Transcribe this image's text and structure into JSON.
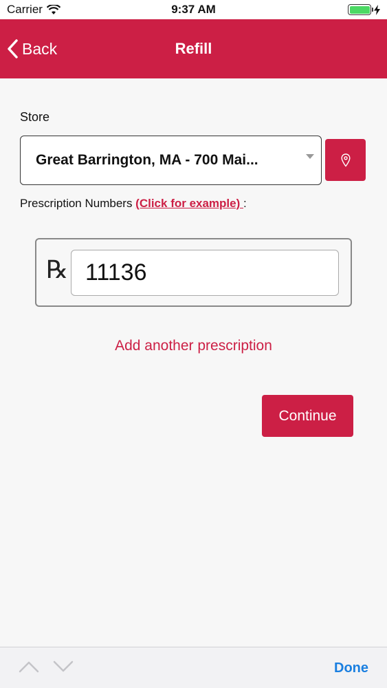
{
  "status_bar": {
    "carrier": "Carrier",
    "time": "9:37 AM"
  },
  "nav": {
    "back_label": "Back",
    "title": "Refill"
  },
  "store": {
    "label": "Store",
    "selected": "Great Barrington, MA - 700 Mai..."
  },
  "prescription": {
    "label": "Prescription Numbers ",
    "example_link": "(Click for example) ",
    "label_suffix": ":",
    "rx_symbol": "℞",
    "number_value": "11136",
    "add_another": "Add another prescription"
  },
  "actions": {
    "continue_label": "Continue"
  },
  "toolbar": {
    "done_label": "Done"
  },
  "colors": {
    "brand": "#cc1f45",
    "done_blue": "#1a7fe0",
    "battery_green": "#4cd964"
  }
}
